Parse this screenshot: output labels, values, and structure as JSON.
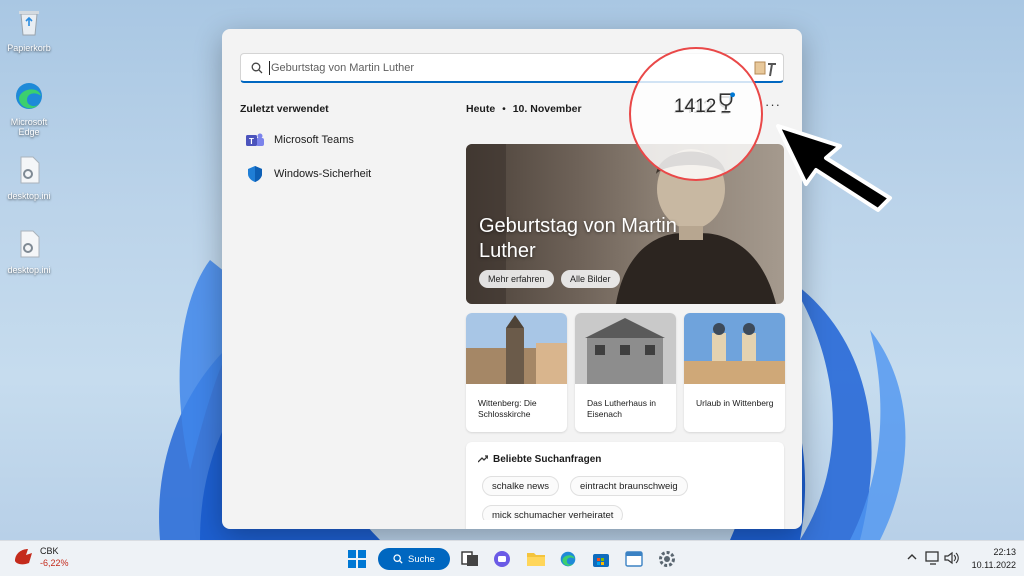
{
  "desktop": {
    "icons": [
      {
        "label": "Papierkorb"
      },
      {
        "label": "Microsoft Edge"
      },
      {
        "label": "desktop.ini"
      },
      {
        "label": "desktop.ini"
      }
    ]
  },
  "search": {
    "value": "Geburtstag von Martin Luther",
    "placeholder": ""
  },
  "recent": {
    "title": "Zuletzt verwendet",
    "items": [
      {
        "label": "Microsoft Teams",
        "icon": "teams-icon"
      },
      {
        "label": "Windows-Sicherheit",
        "icon": "shield-icon"
      }
    ]
  },
  "highlights": {
    "today_label": "Heute",
    "separator": "•",
    "date": "10. November",
    "points": "1412",
    "more": "···"
  },
  "hero": {
    "title": "Geburtstag von Martin Luther",
    "btn_more": "Mehr erfahren",
    "btn_images": "Alle Bilder"
  },
  "cards": [
    {
      "caption": "Wittenberg: Die Schlosskirche"
    },
    {
      "caption": "Das Lutherhaus in Eisenach"
    },
    {
      "caption": "Urlaub in Wittenberg"
    }
  ],
  "popular": {
    "title": "Beliebte Suchanfragen",
    "chips": [
      "schalke news",
      "eintracht braunschweig",
      "mick schumacher verheiratet"
    ]
  },
  "annotation": {
    "points": "1412"
  },
  "taskbar": {
    "stock_name": "CBK",
    "stock_change": "-6,22%",
    "search_label": "Suche",
    "time": "22:13",
    "date": "10.11.2022"
  },
  "colors": {
    "accent": "#0067c0",
    "highlight_ring": "#e94848",
    "stock_negative": "#c42b1c"
  }
}
